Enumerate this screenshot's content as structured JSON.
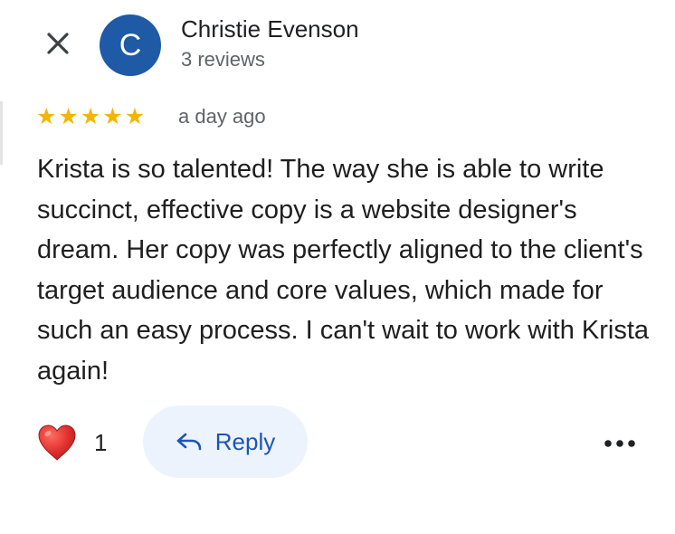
{
  "icons": {
    "close": "close-icon",
    "like": "heart-icon",
    "reply": "reply-arrow-icon",
    "more": "more-horizontal-icon"
  },
  "colors": {
    "avatar_bg": "#1f5aa6",
    "star": "#f4b400",
    "heart": "#e0322f",
    "reply_bg": "#edf3fd",
    "reply_text": "#1a56b5"
  },
  "author": {
    "avatar_letter": "C",
    "name": "Christie Evenson",
    "reviews": "3 reviews"
  },
  "review": {
    "rating": 5,
    "rating_max": 5,
    "date": "a day ago",
    "text": "Krista is so talented! The way she is able to write succinct, effective copy is a website designer's dream. Her copy was perfectly aligned to the client's target audience and core values, which made for such an easy process. I can't wait to work with Krista again!"
  },
  "actions": {
    "like_count": "1",
    "reply_label": "Reply"
  }
}
